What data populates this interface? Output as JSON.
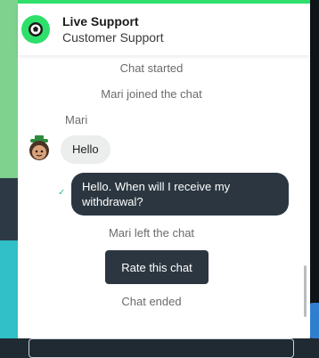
{
  "header": {
    "title": "Live Support",
    "subtitle": "Customer Support",
    "icon": "soccer-ball-icon"
  },
  "messages": {
    "chat_started": "Chat started",
    "agent_joined": "Mari joined the chat",
    "agent_name": "Mari",
    "agent_message": "Hello",
    "user_message": "Hello. When will I receive my withdrawal?",
    "agent_left": "Mari left the chat",
    "chat_ended": "Chat ended"
  },
  "actions": {
    "rate_label": "Rate this chat"
  },
  "colors": {
    "accent": "#2ee06b",
    "dark_bubble": "#2b3640",
    "light_bubble": "#eceded"
  }
}
